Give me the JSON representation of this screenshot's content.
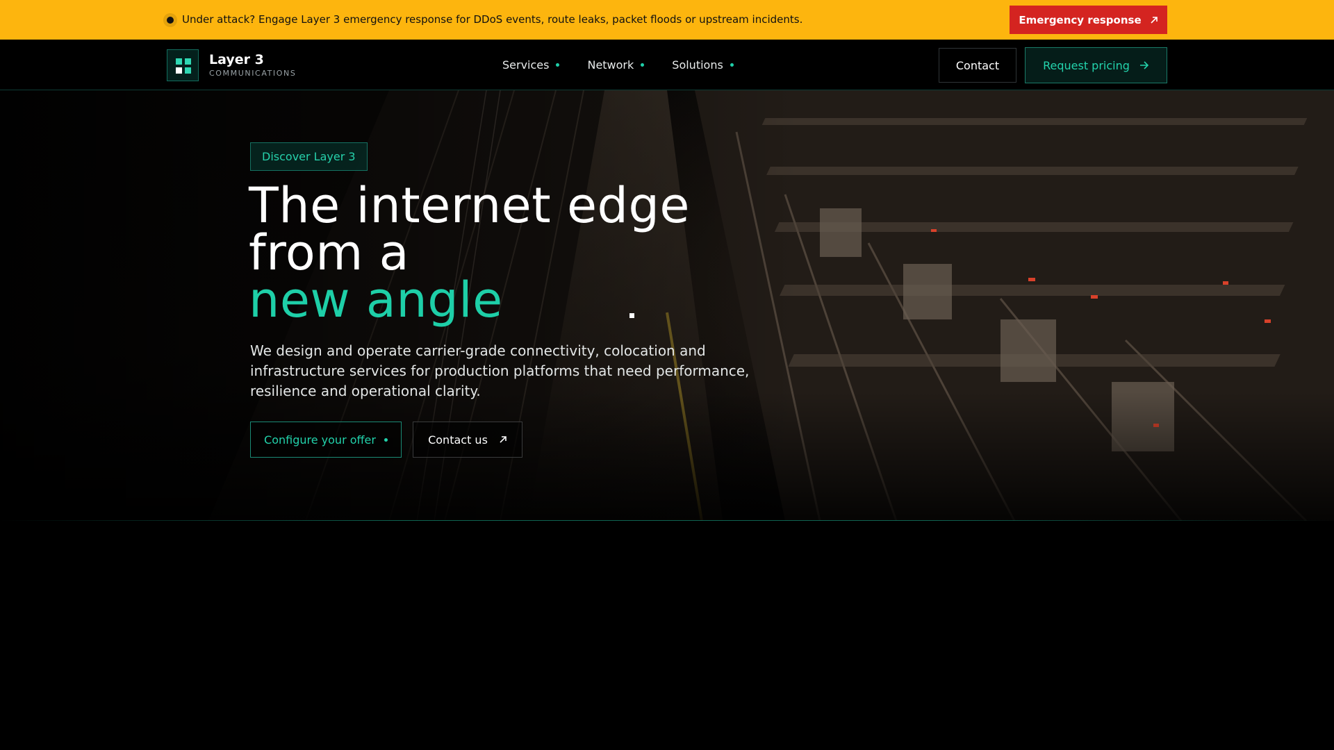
{
  "alert": {
    "text": "Under attack? Engage Layer 3 emergency response for DDoS events, route leaks, packet floods or upstream incidents.",
    "button_label": "Emergency response",
    "background": "#FDB50E",
    "button_color": "#D42420"
  },
  "header": {
    "brand": {
      "name": "Layer 3",
      "subtitle": "COMMUNICATIONS"
    },
    "nav": [
      {
        "label": "Services"
      },
      {
        "label": "Network"
      },
      {
        "label": "Solutions"
      }
    ],
    "contact_label": "Contact",
    "pricing_label": "Request pricing"
  },
  "hero": {
    "tag": "Discover Layer 3",
    "title_line1": "The internet edge",
    "title_line2": "from a",
    "title_accent": "new angle",
    "description": "We design and operate carrier-grade connectivity, colocation and infrastructure services for production platforms that need performance, resilience and operational clarity.",
    "primary_cta": "Configure your offer",
    "secondary_cta": "Contact us"
  },
  "colors": {
    "accent": "#1ECFA8",
    "background": "#000000"
  },
  "icons": {
    "emergency": "arrow-up-right-icon",
    "pricing": "arrow-right-icon",
    "contact_us": "arrow-up-right-icon"
  }
}
